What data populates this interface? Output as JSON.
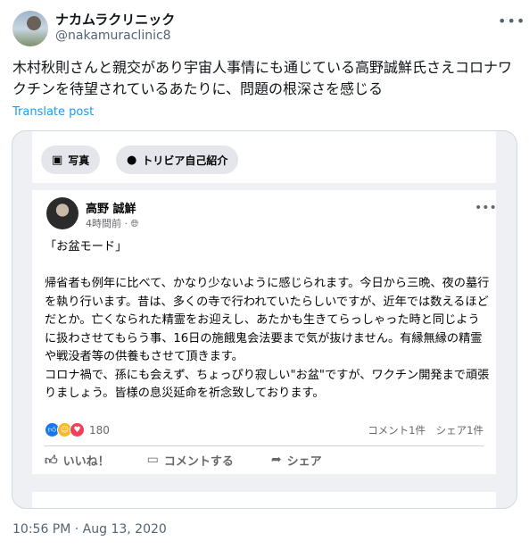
{
  "user": {
    "display_name": "ナカムラクリニック",
    "handle": "@nakamuraclinic8",
    "more_icon": "more-horizontal-icon"
  },
  "tweet": {
    "text": "木村秋則さんと親交があり宇宙人事情にも通じている高野誠鮮氏さえコロナワクチンを待望されているあたりに、問題の根深さを感じる",
    "translate_label": "Translate post",
    "timestamp": "10:56 PM · Aug 13, 2020"
  },
  "media": {
    "tabs": [
      {
        "icon": "photo-icon",
        "label": "写真"
      },
      {
        "icon": "speech-bubble-icon",
        "label": "トリビア自己紹介"
      }
    ],
    "post": {
      "author": "高野 誠鮮",
      "time": "4時間前",
      "privacy_icon": "globe-icon",
      "body": [
        "「お盆モード」",
        "",
        "帰省者も例年に比べて、かなり少ないように感じられます。今日から三晩、夜の墓行を執り行います。昔は、多くの寺で行われていたらしいですが、近年では数えるほどだとか。亡くなられた精霊をお迎えし、あたかも生きてらっしゃった時と同じように扱わさせてもらう事、16日の施餓鬼会法要まで気が抜けません。有縁無縁の精霊や戦没者等の供養もさせて頂きます。",
        "コロナ禍で、孫にも会えず、ちょっぴり寂しい\"お盆\"ですが、ワクチン開発まで頑張りましょう。皆様の息災延命を祈念致しております。"
      ],
      "reactions": {
        "icons": [
          "like-icon",
          "haha-icon",
          "love-icon"
        ],
        "count": "180"
      },
      "comments": "コメント1件",
      "shares": "シェア1件",
      "actions": [
        {
          "icon": "thumbs-up-icon",
          "label": "いいね！"
        },
        {
          "icon": "comment-icon",
          "label": "コメントする"
        },
        {
          "icon": "share-icon",
          "label": "シェア"
        }
      ]
    }
  }
}
